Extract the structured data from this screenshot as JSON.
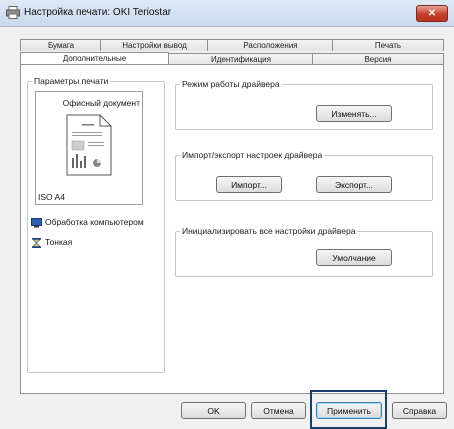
{
  "window": {
    "title": "Настройка печати: OKI Teriostar",
    "close_label": "✕"
  },
  "tabs": {
    "row1": [
      "Бумага",
      "Настройки вывод",
      "Расположения",
      "Печать"
    ],
    "row2": [
      "Дополнительные",
      "Идентификация",
      "Версия"
    ],
    "active": "Дополнительные"
  },
  "print_params": {
    "group_title": "Параметры печати",
    "preview_title": "Офисный документ",
    "paper_size": "ISO A4",
    "options": [
      {
        "icon": "computer-icon",
        "label": "Обработка компьютером"
      },
      {
        "icon": "hourglass-icon",
        "label": "Тонкая"
      }
    ]
  },
  "driver_mode": {
    "group_title": "Режим работы драйвера",
    "change_button": "Изменять..."
  },
  "import_export": {
    "group_title": "Импорт/экспорт настроек драйвера",
    "import_button": "Импорт...",
    "export_button": "Экспорт..."
  },
  "reset": {
    "group_title": "Инициализировать все настройки драйвера",
    "default_button": "Умолчание"
  },
  "footer": {
    "ok": "OK",
    "cancel": "Отмена",
    "apply": "Применить",
    "help": "Справка"
  }
}
